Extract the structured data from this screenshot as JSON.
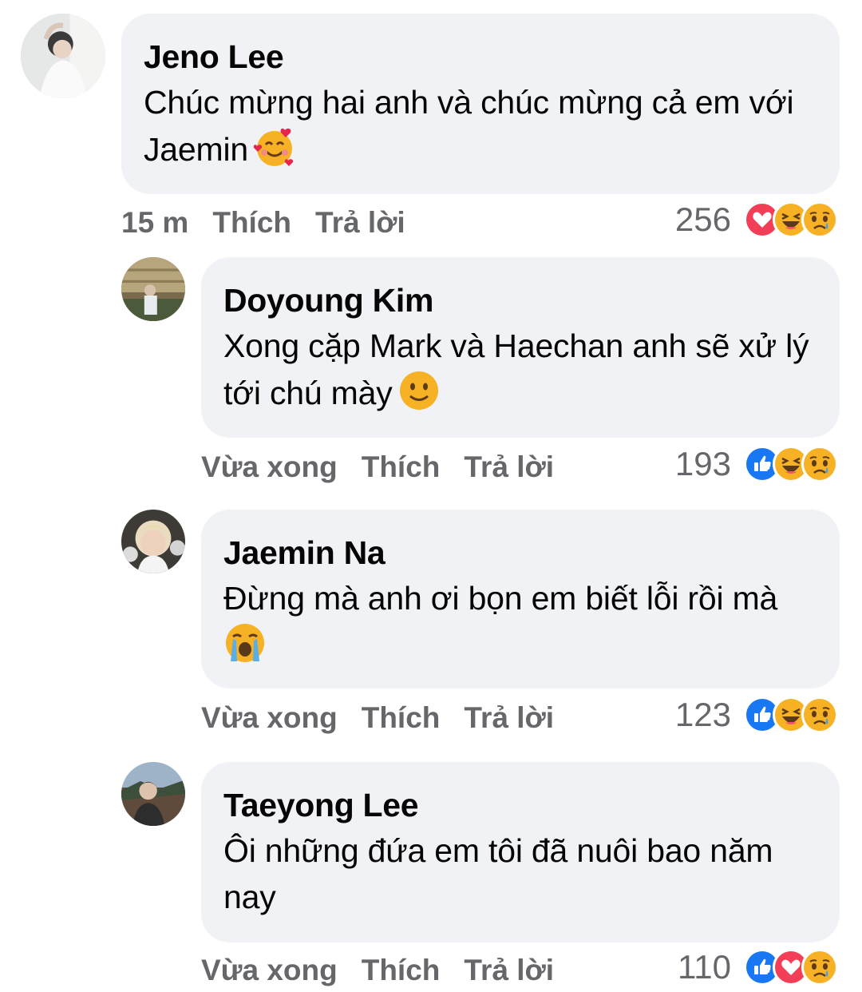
{
  "comments": [
    {
      "author": "Jeno Lee",
      "text": "Chúc mừng hai anh và chúc mừng cả em với Jaemin",
      "emoji": "smiling-face-with-hearts",
      "time": "15 m",
      "like_label": "Thích",
      "reply_label": "Trả lời",
      "reaction_count": "256",
      "reactions": [
        "love",
        "haha",
        "sad"
      ]
    },
    {
      "author": "Doyoung Kim",
      "text": "Xong cặp Mark và Haechan anh sẽ xử lý tới chú mày",
      "emoji": "slightly-smiling-face",
      "time": "Vừa xong",
      "like_label": "Thích",
      "reply_label": "Trả lời",
      "reaction_count": "193",
      "reactions": [
        "like",
        "haha",
        "sad"
      ]
    },
    {
      "author": "Jaemin Na",
      "text": "Đừng mà anh ơi bọn em biết lỗi rồi mà",
      "emoji": "loudly-crying-face",
      "time": "Vừa xong",
      "like_label": "Thích",
      "reply_label": "Trả lời",
      "reaction_count": "123",
      "reactions": [
        "like",
        "haha",
        "sad"
      ]
    },
    {
      "author": "Taeyong Lee",
      "text": "Ôi những đứa em tôi đã nuôi bao năm nay",
      "emoji": "",
      "time": "Vừa xong",
      "like_label": "Thích",
      "reply_label": "Trả lời",
      "reaction_count": "110",
      "reactions": [
        "like",
        "love",
        "sad"
      ]
    }
  ],
  "colors": {
    "bubble": "#f0f2f5",
    "meta_text": "#65676b",
    "like_blue": "#1877f2",
    "love_red": "#f33e58",
    "emoji_yellow": "#f7b125"
  }
}
